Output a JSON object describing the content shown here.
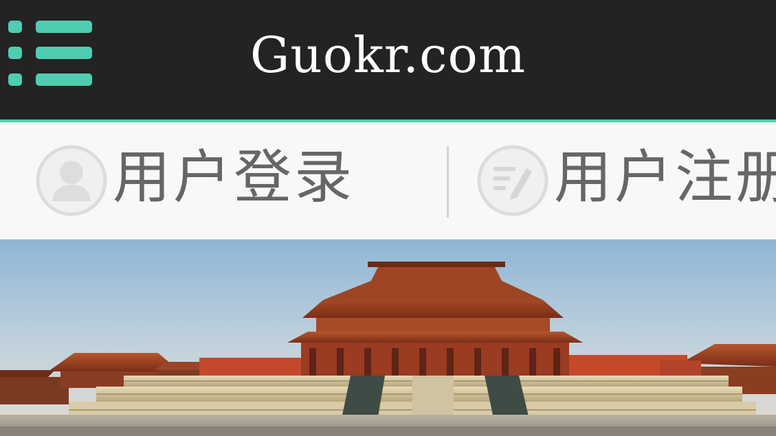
{
  "header": {
    "title": "Guokr.com",
    "menu_icon": "list-menu-icon",
    "accent_color": "#4ecdb1",
    "background_color": "#232323"
  },
  "auth": {
    "login_label": "用户登录",
    "login_icon": "user-avatar-icon",
    "register_label": "用户注册",
    "register_icon": "edit-form-icon"
  },
  "banner": {
    "image": "forbidden-city-palace-photo"
  }
}
